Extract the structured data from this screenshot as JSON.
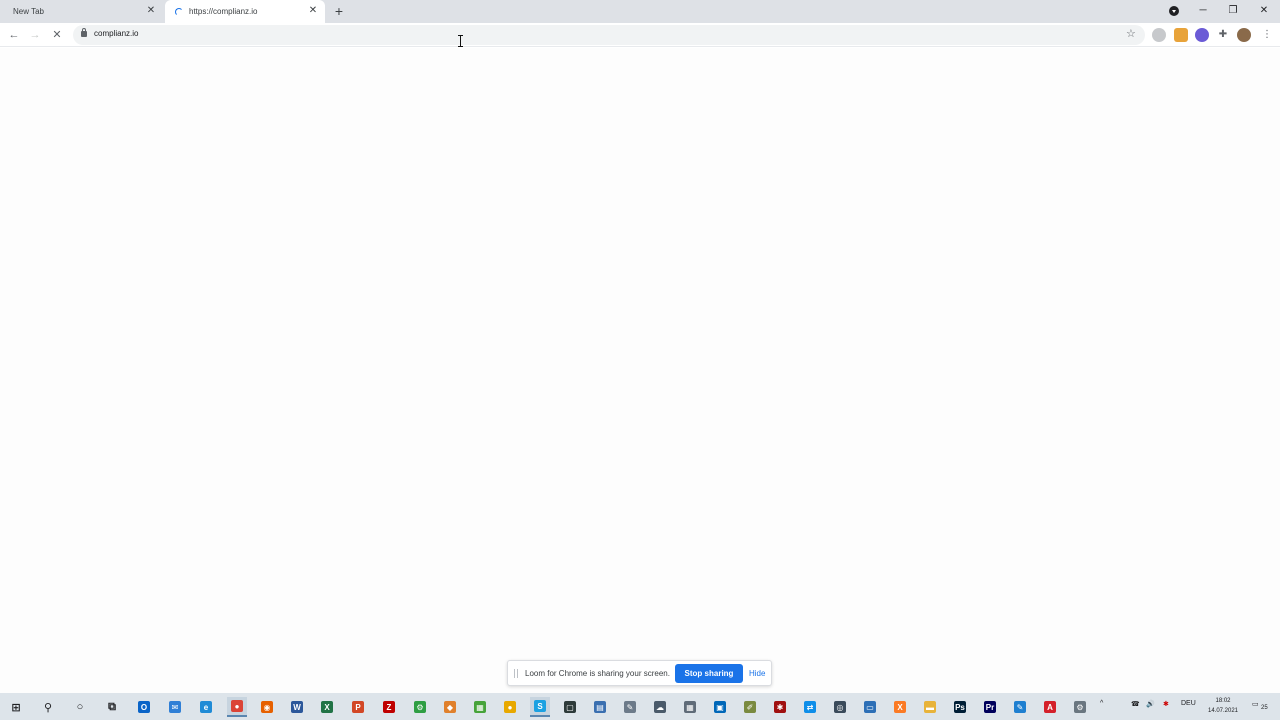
{
  "browser": {
    "tabs": [
      {
        "title": "New Tab",
        "active": false
      },
      {
        "title": "https://complianz.io",
        "active": true,
        "loading": true
      }
    ],
    "url": "complianz.io",
    "accent": "#1a73e8"
  },
  "share_bar": {
    "message": "Loom for Chrome is sharing your screen.",
    "stop_label": "Stop sharing",
    "hide_label": "Hide"
  },
  "taskbar": {
    "language": "DEU",
    "time": "18:02",
    "date": "14.07.2021",
    "notification_count": "25",
    "apps": [
      {
        "name": "windows-start",
        "color": "#202124",
        "glyph": "⊞"
      },
      {
        "name": "search",
        "color": "#202124",
        "glyph": "⚲"
      },
      {
        "name": "cortana",
        "color": "#202124",
        "glyph": "○"
      },
      {
        "name": "task-view",
        "color": "#202124",
        "glyph": "⧉"
      },
      {
        "name": "outlook",
        "color": "#0a64c8",
        "glyph": "O"
      },
      {
        "name": "app-blue",
        "color": "#2f7fd6",
        "glyph": "✉"
      },
      {
        "name": "edge",
        "color": "#1f8bd6",
        "glyph": "e"
      },
      {
        "name": "chrome",
        "color": "#db4437",
        "glyph": "●"
      },
      {
        "name": "firefox",
        "color": "#e66000",
        "glyph": "◉"
      },
      {
        "name": "word",
        "color": "#2b579a",
        "glyph": "W"
      },
      {
        "name": "excel",
        "color": "#217346",
        "glyph": "X"
      },
      {
        "name": "powerpoint",
        "color": "#d24726",
        "glyph": "P"
      },
      {
        "name": "filezilla",
        "color": "#bf0000",
        "glyph": "Z"
      },
      {
        "name": "app-green",
        "color": "#2e9e43",
        "glyph": "⚙"
      },
      {
        "name": "app-orange",
        "color": "#e0802c",
        "glyph": "◆"
      },
      {
        "name": "app-green2",
        "color": "#46a33a",
        "glyph": "▦"
      },
      {
        "name": "app-yellow",
        "color": "#e8a800",
        "glyph": "●"
      },
      {
        "name": "app-teal",
        "color": "#1ba1e2",
        "glyph": "S"
      },
      {
        "name": "app-dark",
        "color": "#2d3a3a",
        "glyph": "▢"
      },
      {
        "name": "app-doc",
        "color": "#3a6fb0",
        "glyph": "▤"
      },
      {
        "name": "app-tool",
        "color": "#6c7a89",
        "glyph": "✎"
      },
      {
        "name": "app-cloud",
        "color": "#4a5a6a",
        "glyph": "☁"
      },
      {
        "name": "calculator",
        "color": "#5f6b78",
        "glyph": "▦"
      },
      {
        "name": "app-store",
        "color": "#0067b8",
        "glyph": "▣"
      },
      {
        "name": "app-pen",
        "color": "#7a8a40",
        "glyph": "✐"
      },
      {
        "name": "app-red",
        "color": "#a01010",
        "glyph": "✱"
      },
      {
        "name": "teamviewer",
        "color": "#0e8ee9",
        "glyph": "⇄"
      },
      {
        "name": "app-circle",
        "color": "#3a4a5a",
        "glyph": "◎"
      },
      {
        "name": "app-monitor",
        "color": "#2d6fb6",
        "glyph": "▭"
      },
      {
        "name": "xampp",
        "color": "#fb7a24",
        "glyph": "X"
      },
      {
        "name": "explorer",
        "color": "#e8b33a",
        "glyph": "▬"
      },
      {
        "name": "photoshop",
        "color": "#001e36",
        "glyph": "Ps"
      },
      {
        "name": "premiere",
        "color": "#00005b",
        "glyph": "Pr"
      },
      {
        "name": "app-paint",
        "color": "#1e7fd0",
        "glyph": "✎"
      },
      {
        "name": "acrobat",
        "color": "#d4202a",
        "glyph": "A"
      },
      {
        "name": "app-gray",
        "color": "#6a7680",
        "glyph": "⚙"
      }
    ]
  }
}
